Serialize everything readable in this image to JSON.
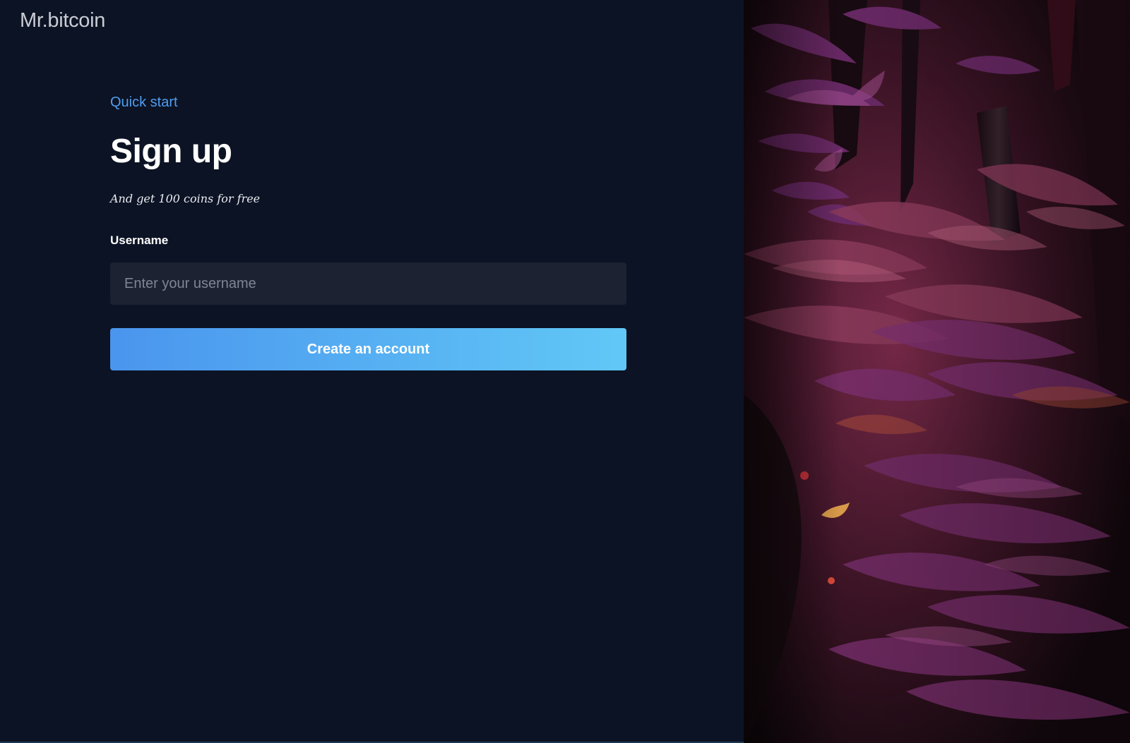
{
  "brand": {
    "name": "Mr.bitcoin"
  },
  "signup": {
    "eyebrow": "Quick start",
    "title": "Sign up",
    "subtitle": "And get 100 coins for free",
    "username_label": "Username",
    "username_placeholder": "Enter your username",
    "username_value": "",
    "submit_label": "Create an account"
  },
  "photo": {
    "icon": "jungle-ferns-photo"
  },
  "colors": {
    "background": "#0c1324",
    "accent": "#4f9ef0",
    "button_gradient_start": "#4a95ee",
    "button_gradient_end": "#61c8f6",
    "input_background": "#1c2232"
  }
}
